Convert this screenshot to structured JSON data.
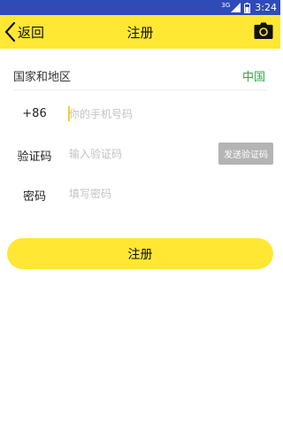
{
  "status_bar": {
    "network": "3G",
    "time": "3:24",
    "icons": [
      "signal-icon",
      "battery-icon"
    ]
  },
  "header": {
    "back_label": "返回",
    "title": "注册",
    "icons": [
      "back-chevron-icon",
      "camera-icon"
    ]
  },
  "form": {
    "country_label": "国家和地区",
    "country_value": "中国",
    "phone_prefix": "+86",
    "phone_placeholder": "你的手机号码",
    "code_label": "验证码",
    "code_placeholder": "输入验证码",
    "send_code_label": "发送验证码",
    "password_label": "密码",
    "password_placeholder": "填写密码"
  },
  "actions": {
    "register_label": "注册"
  },
  "colors": {
    "status_bar": "#2f4bb7",
    "accent_yellow": "#ffe733",
    "country_green": "#2da84a",
    "disabled_gray": "#b4b4b4"
  }
}
